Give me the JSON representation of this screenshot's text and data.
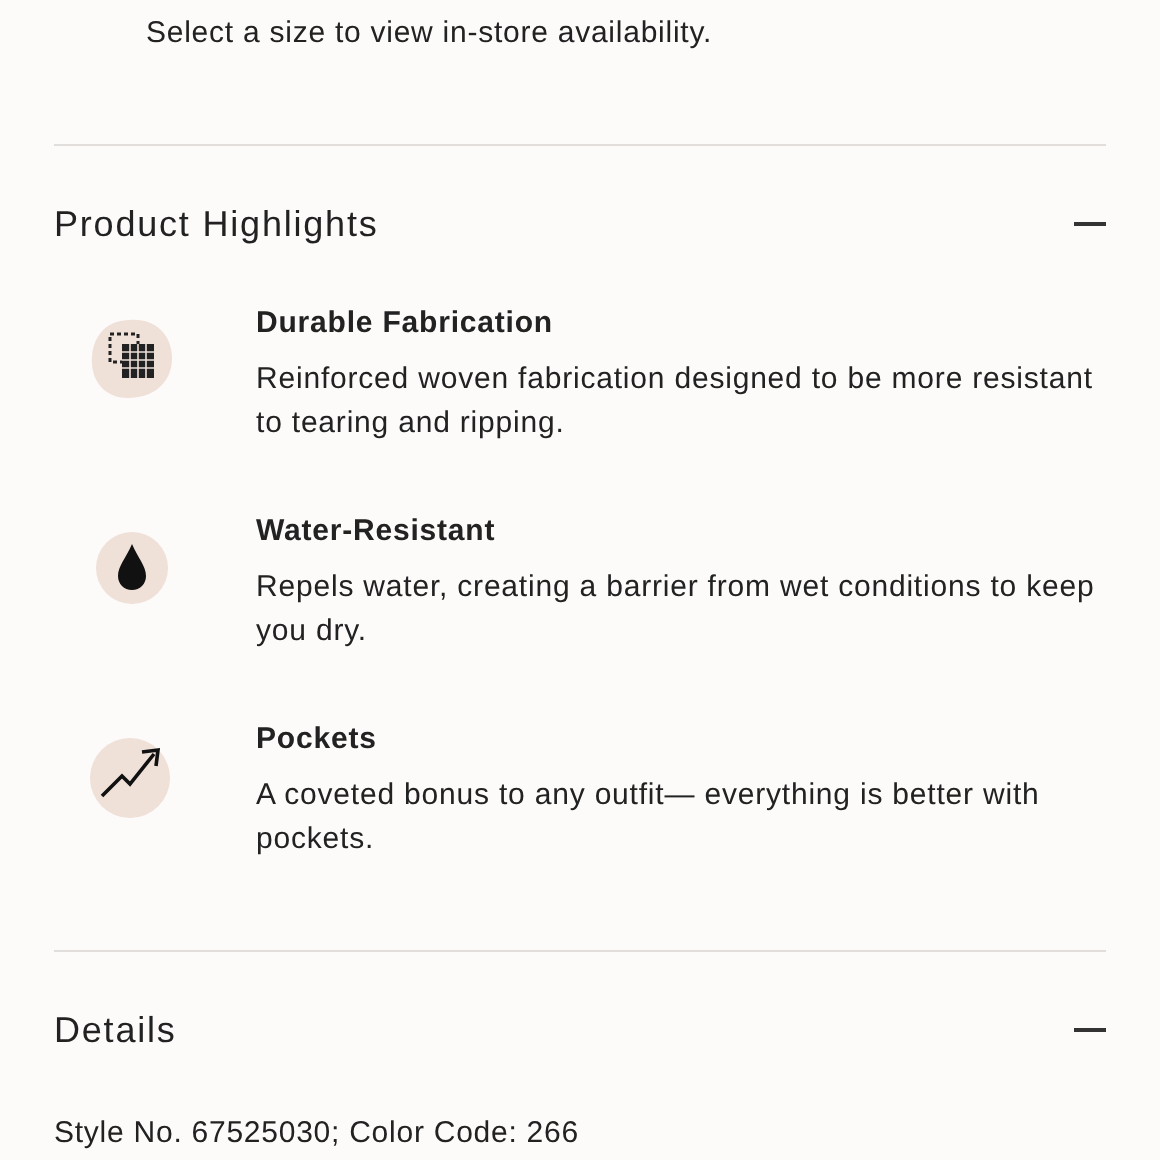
{
  "availability_note": "Select a size to view in-store availability.",
  "sections": [
    {
      "title": "Product Highlights",
      "expanded": true,
      "highlights": [
        {
          "kind": "fabric",
          "title": "Durable Fabrication",
          "text": "Reinforced woven fabrication designed to be more resistant to tearing and ripping."
        },
        {
          "kind": "drop",
          "title": "Water-Resistant",
          "text": "Repels water, creating a barrier from wet conditions to keep you dry."
        },
        {
          "kind": "trend",
          "title": "Pockets",
          "text": "A coveted bonus to any outfit— everything is better with pockets."
        }
      ]
    },
    {
      "title": "Details",
      "expanded": true,
      "lines": [
        "Style No. 67525030; Color Code: 266"
      ]
    }
  ]
}
